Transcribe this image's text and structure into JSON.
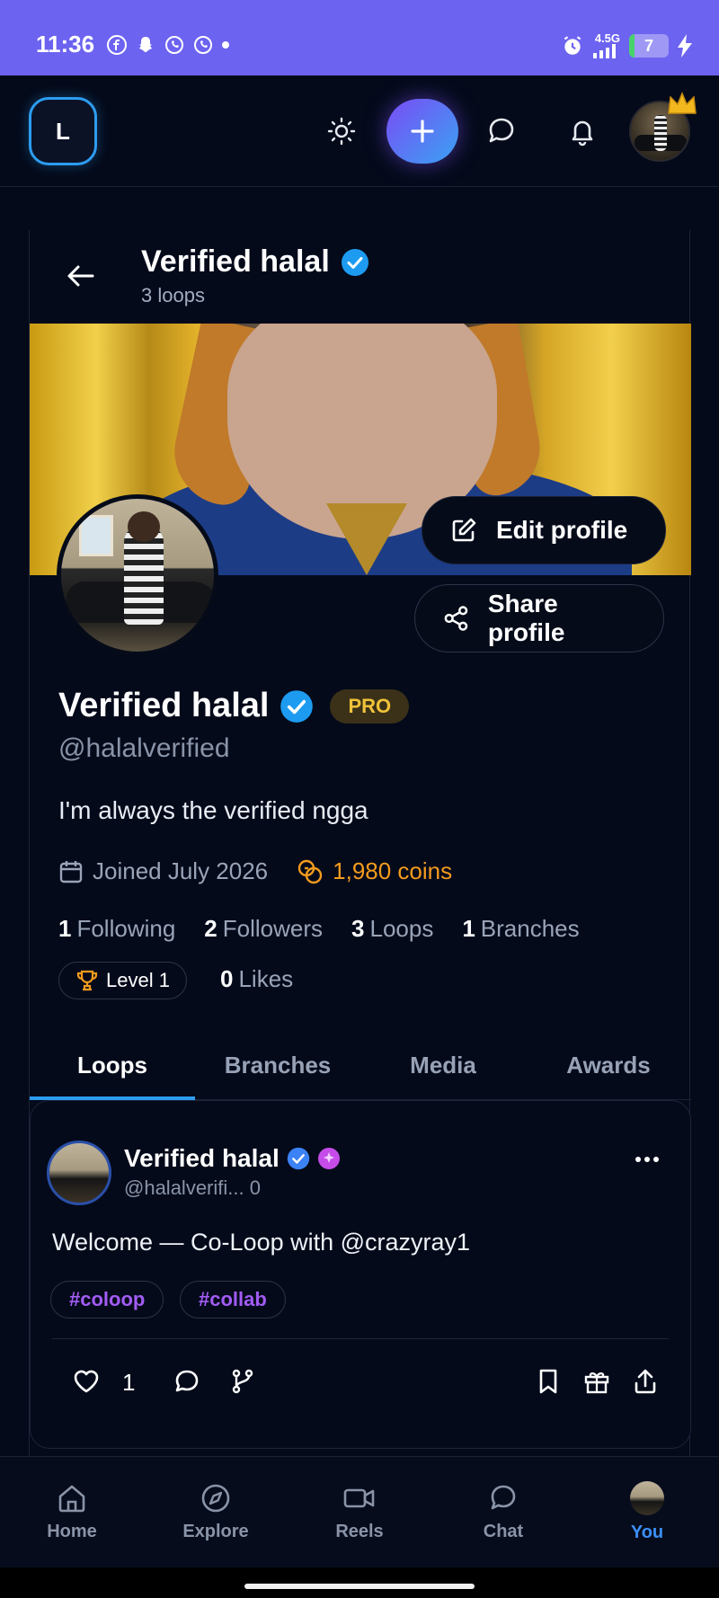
{
  "status_bar": {
    "time": "11:36",
    "network": "4.5G",
    "battery": "7"
  },
  "header": {
    "logo_letter": "L"
  },
  "profile_header": {
    "name": "Verified halal",
    "loops_count": "3 loops"
  },
  "profile": {
    "display_name": "Verified halal",
    "pro_badge": "PRO",
    "handle": "@halalverified",
    "bio": "I'm always the verified ngga",
    "joined": "Joined July 2026",
    "coins": "1,980 coins",
    "edit_label": "Edit profile",
    "share_label": "Share profile"
  },
  "stats": [
    {
      "value": "1",
      "label": "Following"
    },
    {
      "value": "2",
      "label": "Followers"
    },
    {
      "value": "3",
      "label": "Loops"
    },
    {
      "value": "1",
      "label": "Branches"
    }
  ],
  "level": {
    "label": "Level 1"
  },
  "likes": {
    "value": "0",
    "label": "Likes"
  },
  "tabs": [
    {
      "label": "Loops",
      "active": true
    },
    {
      "label": "Branches",
      "active": false
    },
    {
      "label": "Media",
      "active": false
    },
    {
      "label": "Awards",
      "active": false
    }
  ],
  "post": {
    "author": "Verified halal",
    "handle_meta": "@halalverifi... 0",
    "text": "Welcome — Co-Loop with @crazyray1",
    "tags": [
      "#coloop",
      "#collab"
    ],
    "like_count": "1"
  },
  "bottom_nav": [
    {
      "label": "Home",
      "icon": "home-icon"
    },
    {
      "label": "Explore",
      "icon": "compass-icon"
    },
    {
      "label": "Reels",
      "icon": "video-icon"
    },
    {
      "label": "Chat",
      "icon": "chat-icon"
    },
    {
      "label": "You",
      "icon": "avatar",
      "active": true
    }
  ],
  "colors": {
    "accent": "#2d9cf0",
    "coins": "#f39b1d",
    "pro": "#f0c23a",
    "tag": "#a25cf5",
    "background": "#040a1a"
  }
}
